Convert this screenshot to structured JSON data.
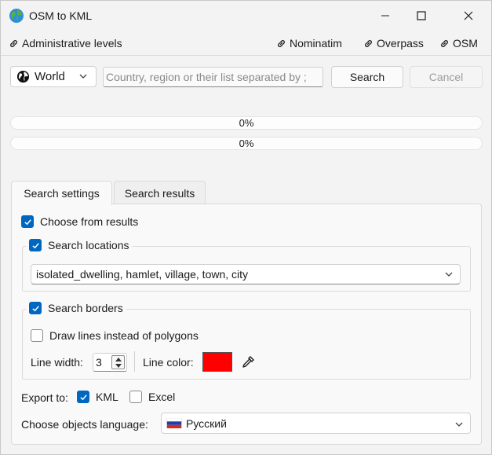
{
  "window": {
    "title": "OSM to KML",
    "icon": "globe-icon"
  },
  "linkbar": {
    "admin_levels": "Administrative levels",
    "nominatim": "Nominatim",
    "overpass": "Overpass",
    "osm": "OSM"
  },
  "search": {
    "region": "World",
    "placeholder": "Country, region or their list separated by ;",
    "value": "",
    "search_label": "Search",
    "cancel_label": "Cancel"
  },
  "progress": [
    {
      "text": "0%",
      "value": 0
    },
    {
      "text": "0%",
      "value": 0
    }
  ],
  "tabs": {
    "settings": "Search settings",
    "results": "Search results",
    "active": "settings"
  },
  "settings": {
    "choose_from_results": {
      "label": "Choose from results",
      "checked": true
    },
    "search_locations": {
      "label": "Search locations",
      "checked": true
    },
    "locations_value": "isolated_dwelling, hamlet, village, town, city",
    "search_borders": {
      "label": "Search borders",
      "checked": true
    },
    "draw_lines": {
      "label": "Draw lines instead of polygons",
      "checked": false
    },
    "line_width_label": "Line width:",
    "line_width": "3",
    "line_color_label": "Line color:",
    "line_color": "#ff0000",
    "export_label": "Export to:",
    "export_kml": {
      "label": "KML",
      "checked": true
    },
    "export_excel": {
      "label": "Excel",
      "checked": false
    },
    "language_label": "Choose objects language:",
    "language": "Русский"
  },
  "colors": {
    "accent": "#0067c0",
    "background": "#f3f3f3"
  }
}
